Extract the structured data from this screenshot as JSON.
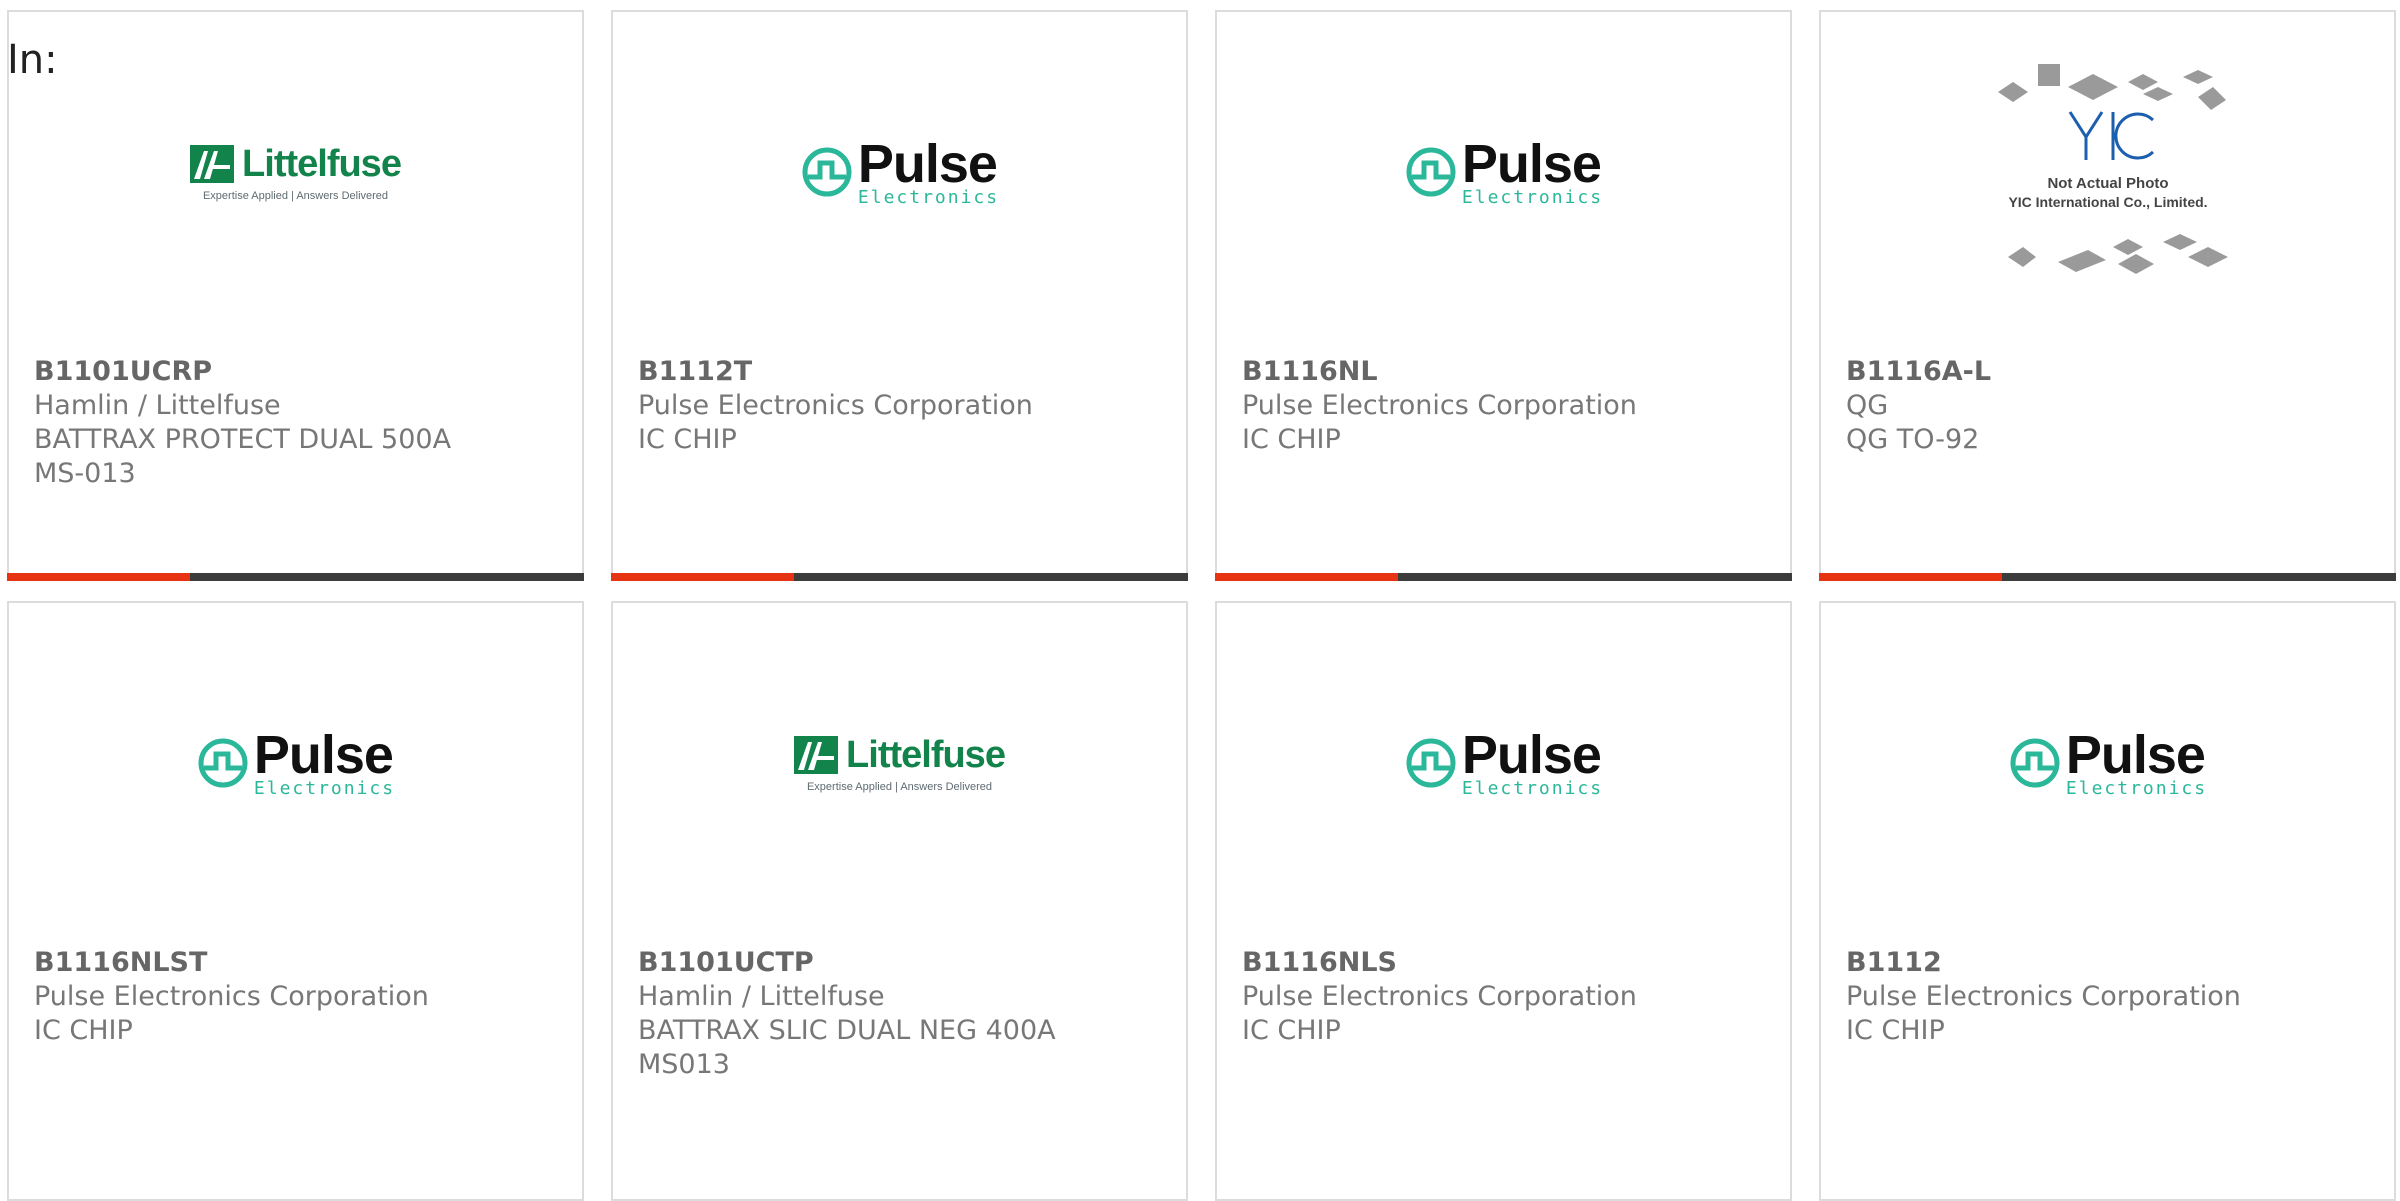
{
  "header": {
    "label": "In:"
  },
  "logos": {
    "littelfuse": {
      "name": "Littelfuse",
      "tagline": "Expertise Applied | Answers Delivered"
    },
    "pulse": {
      "name": "Pulse",
      "sub": "Electronics"
    },
    "yic": {
      "logo_text": "YIC",
      "line1": "Not Actual Photo",
      "line2": "YIC International Co., Limited."
    }
  },
  "colors": {
    "accent": "#e63312",
    "bar": "#3c3c3c",
    "littelfuse_green": "#12834b",
    "pulse_teal": "#2bb89a",
    "yic_blue": "#1c5fae"
  },
  "products": [
    {
      "part": "B1101UCRP",
      "manufacturer": "Hamlin / Littelfuse",
      "description": "BATTRAX PROTECT DUAL 500A",
      "package": "MS-013",
      "logo": "littelfuse"
    },
    {
      "part": "B1112T",
      "manufacturer": "Pulse Electronics Corporation",
      "description": "IC CHIP",
      "package": "",
      "logo": "pulse"
    },
    {
      "part": "B1116NL",
      "manufacturer": "Pulse Electronics Corporation",
      "description": "IC CHIP",
      "package": "",
      "logo": "pulse"
    },
    {
      "part": "B1116A-L",
      "manufacturer": "QG",
      "description": "QG TO-92",
      "package": "",
      "logo": "yic"
    },
    {
      "part": "B1116NLST",
      "manufacturer": "Pulse Electronics Corporation",
      "description": "IC CHIP",
      "package": "",
      "logo": "pulse"
    },
    {
      "part": "B1101UCTP",
      "manufacturer": "Hamlin / Littelfuse",
      "description": "BATTRAX SLIC DUAL NEG 400A",
      "package": "MS013",
      "logo": "littelfuse"
    },
    {
      "part": "B1116NLS",
      "manufacturer": "Pulse Electronics Corporation",
      "description": "IC CHIP",
      "package": "",
      "logo": "pulse"
    },
    {
      "part": "B1112",
      "manufacturer": "Pulse Electronics Corporation",
      "description": "IC CHIP",
      "package": "",
      "logo": "pulse"
    }
  ]
}
